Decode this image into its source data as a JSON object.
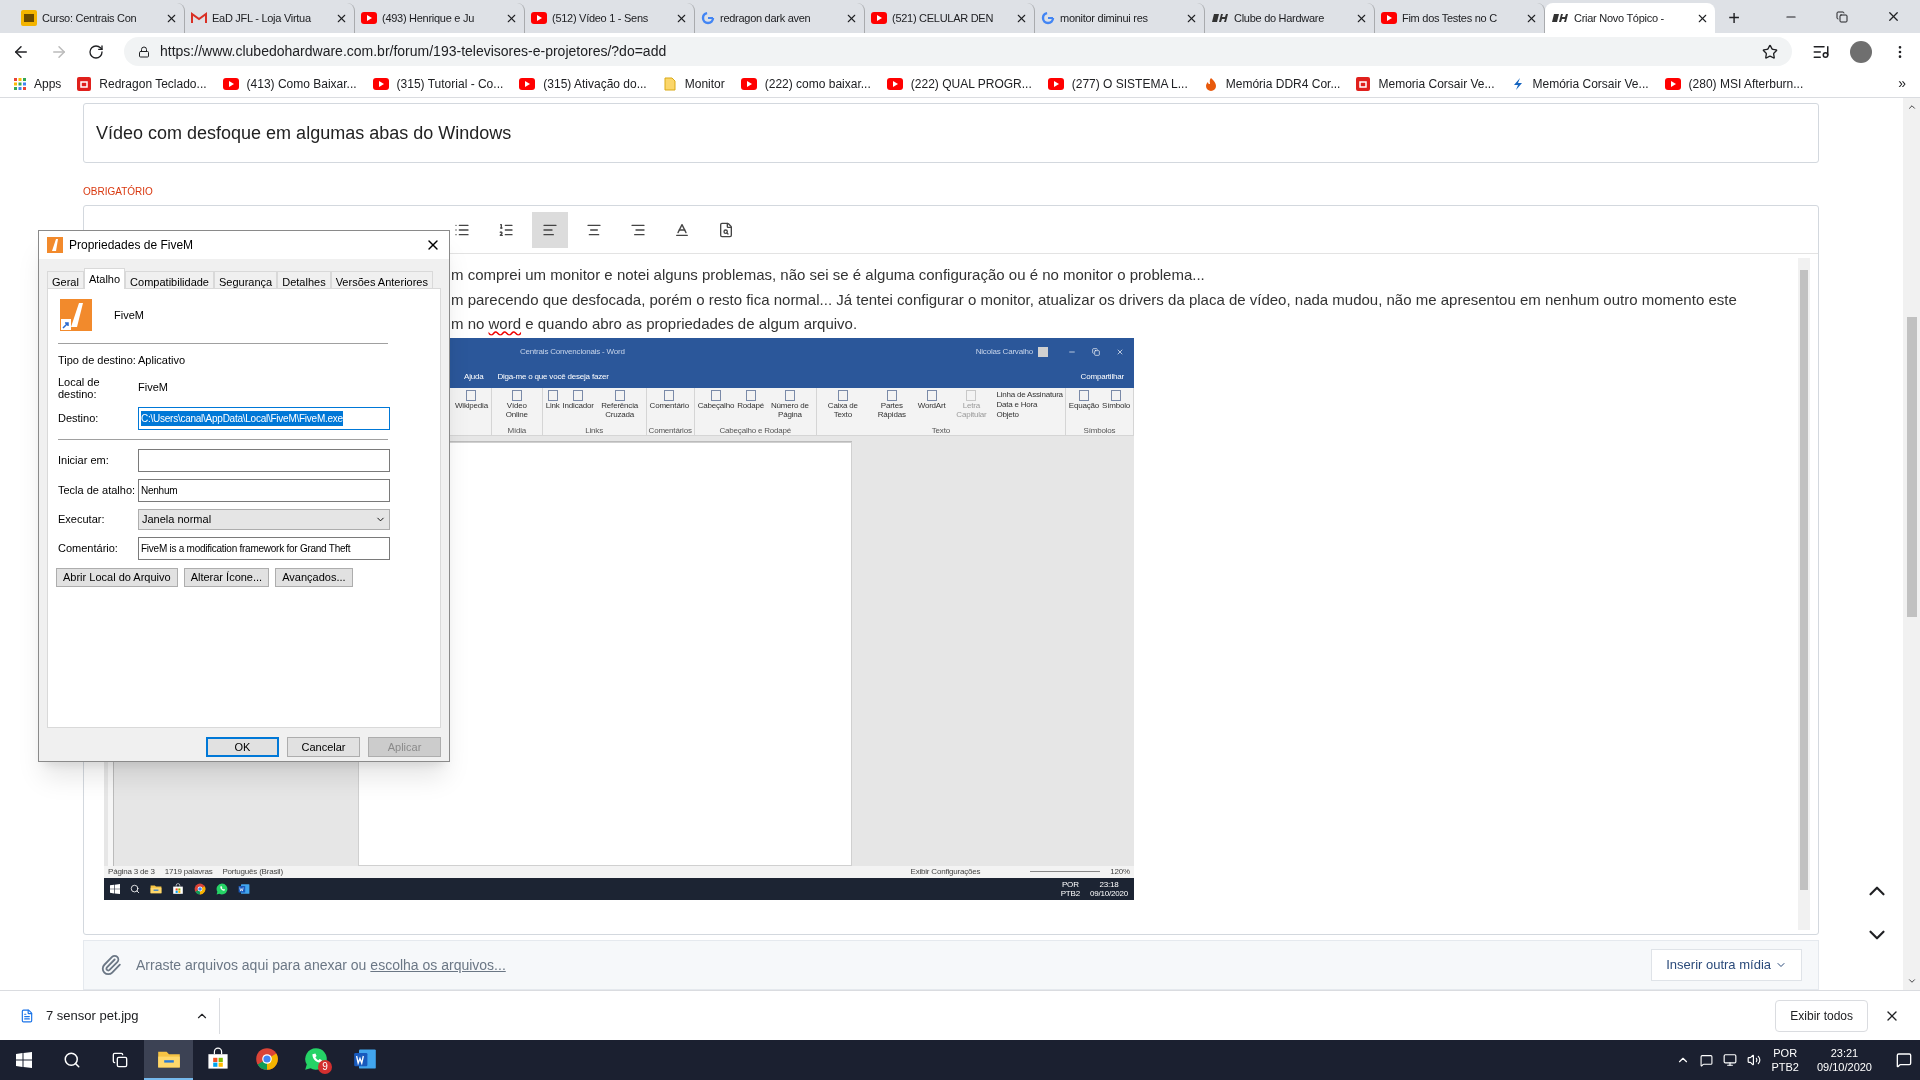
{
  "browser": {
    "tabs": [
      {
        "title": "Curso: Centrais Con",
        "kind": "course",
        "selected": false
      },
      {
        "title": "EaD JFL - Loja Virtua",
        "kind": "gmail",
        "selected": false
      },
      {
        "title": "(493) Henrique e Ju",
        "kind": "youtube",
        "selected": false
      },
      {
        "title": "(512) Vídeo 1 - Sens",
        "kind": "youtube",
        "selected": false
      },
      {
        "title": "redragon dark aven",
        "kind": "google",
        "selected": false
      },
      {
        "title": "(521) CELULAR DEN",
        "kind": "youtube",
        "selected": false
      },
      {
        "title": "monitor diminui res",
        "kind": "google",
        "selected": false
      },
      {
        "title": "Clube do Hardware",
        "kind": "clube",
        "selected": false
      },
      {
        "title": "Fim dos Testes no C",
        "kind": "youtube",
        "selected": false
      },
      {
        "title": "Criar Novo Tópico -",
        "kind": "clube",
        "selected": true
      }
    ],
    "new_tab": "+",
    "url": "https://www.clubedohardware.com.br/forum/193-televisores-e-projetores/?do=add",
    "bookmarks": [
      {
        "label": "Apps",
        "kind": "apps"
      },
      {
        "label": "Redragon Teclado...",
        "kind": "store"
      },
      {
        "label": "(413) Como Baixar...",
        "kind": "youtube"
      },
      {
        "label": "(315) Tutorial - Co...",
        "kind": "youtube"
      },
      {
        "label": "(315) Ativação do...",
        "kind": "youtube"
      },
      {
        "label": "Monitor",
        "kind": "folder"
      },
      {
        "label": "(222) como baixar...",
        "kind": "youtube"
      },
      {
        "label": "(222) QUAL PROGR...",
        "kind": "youtube"
      },
      {
        "label": "(277) O SISTEMA L...",
        "kind": "youtube"
      },
      {
        "label": "Memória DDR4 Cor...",
        "kind": "flame"
      },
      {
        "label": "Memoria Corsair Ve...",
        "kind": "store"
      },
      {
        "label": "Memória Corsair Ve...",
        "kind": "bolt"
      },
      {
        "label": "(280) MSI Afterburn...",
        "kind": "youtube"
      }
    ],
    "bookmarks_more": "»"
  },
  "topic": {
    "title_value": "Vídeo com desfoque em algumas abas do Windows",
    "required_label": "OBRIGATÓRIO",
    "toolbar": [
      {
        "kind": "bullets",
        "selected": false
      },
      {
        "kind": "numbers",
        "selected": false
      },
      {
        "kind": "align-left",
        "selected": true
      },
      {
        "kind": "align-center",
        "selected": false
      },
      {
        "kind": "align-right",
        "selected": false
      },
      {
        "kind": "text-color",
        "selected": false
      },
      {
        "kind": "preview",
        "selected": false
      }
    ],
    "body_lines": [
      {
        "segments": [
          {
            "text": "m comprei um monitor e notei alguns problemas, não sei se é alguma configuração ou é no monitor o problema...",
            "misspelled": false
          }
        ]
      },
      {
        "segments": [
          {
            "text": "m parecendo que desfocada, porém o resto fica normal... Já tentei configurar o monitor, atualizar os drivers da placa de vídeo, nada mudou, não me apresentou em nenhum outro momento este",
            "misspelled": false
          }
        ]
      },
      {
        "segments": [
          {
            "text": "m no ",
            "misspelled": false
          },
          {
            "text": "word",
            "misspelled": true
          },
          {
            "text": " e quando abro as propriedades de algum arquivo.",
            "misspelled": false
          }
        ]
      }
    ],
    "attach_text": "Arraste arquivos aqui para anexar ou",
    "attach_link": "escolha os arquivos...",
    "media_button": "Inserir outra mídia"
  },
  "word_screenshot": {
    "title": "Centrais Convencionais - Word",
    "user": "Nicolas Carvalho",
    "menu": "Ajuda",
    "tell_me": "Diga-me o que você deseja fazer",
    "share": "Compartilhar",
    "groups": [
      {
        "items": [
          {
            "label": "Wikipedia",
            "disabled": false
          }
        ]
      },
      {
        "name": "Mídia",
        "items": [
          {
            "label": "Vídeo Online",
            "disabled": false
          }
        ]
      },
      {
        "name": "Links",
        "items": [
          {
            "label": "Link",
            "disabled": false
          },
          {
            "label": "Indicador",
            "disabled": false
          },
          {
            "label": "Referência Cruzada",
            "disabled": false
          }
        ]
      },
      {
        "name": "Comentários",
        "items": [
          {
            "label": "Comentário",
            "disabled": false
          }
        ]
      },
      {
        "name": "Cabeçalho e Rodapé",
        "items": [
          {
            "label": "Cabeçalho",
            "disabled": false
          },
          {
            "label": "Rodapé",
            "disabled": false
          },
          {
            "label": "Número de Página",
            "disabled": false
          }
        ]
      },
      {
        "name": "Texto",
        "items": [
          {
            "label": "Caixa de Texto",
            "disabled": false
          },
          {
            "label": "Partes Rápidas",
            "disabled": false
          },
          {
            "label": "WordArt",
            "disabled": false
          },
          {
            "label": "Letra Capitular",
            "disabled": true
          }
        ],
        "small_items": [
          "Linha de Assinatura",
          "Data e Hora",
          "Objeto"
        ]
      },
      {
        "name": "Símbolos",
        "items": [
          {
            "label": "Equação",
            "disabled": false
          },
          {
            "label": "Símbolo",
            "disabled": false
          }
        ]
      }
    ],
    "status_left": [
      "Página 3 de 3",
      "1719 palavras",
      "Português (Brasil)"
    ],
    "view_settings": "Exibir Configurações",
    "zoom": "120%",
    "tray_lang": "POR",
    "tray_layout": "PTB2",
    "time": "23:18",
    "date": "09/10/2020"
  },
  "dialog": {
    "title": "Propriedades de FiveM",
    "tabs": [
      {
        "label": "Geral",
        "selected": false
      },
      {
        "label": "Atalho",
        "selected": true
      },
      {
        "label": "Compatibilidade",
        "selected": false
      },
      {
        "label": "Segurança",
        "selected": false
      },
      {
        "label": "Detalhes",
        "selected": false
      },
      {
        "label": "Versões Anteriores",
        "selected": false
      }
    ],
    "app_name": "FiveM",
    "rows": [
      {
        "kind": "static",
        "label": "Tipo de destino:",
        "value": "Aplicativo"
      },
      {
        "kind": "static",
        "label": "Local de destino:",
        "value": "FiveM"
      },
      {
        "kind": "input",
        "label": "Destino:",
        "value": "C:\\Users\\canal\\AppData\\Local\\FiveM\\FiveM.exe",
        "highlighted": true
      },
      {
        "kind": "separator"
      },
      {
        "kind": "input",
        "label": "Iniciar em:",
        "highlighted": false
      },
      {
        "kind": "input",
        "label": "Tecla de atalho:",
        "value": "Nenhum",
        "highlighted": false
      },
      {
        "kind": "select",
        "label": "Executar:",
        "value": "Janela normal"
      },
      {
        "kind": "input",
        "label": "Comentário:",
        "value": "FiveM is a modification framework for Grand Theft",
        "highlighted": false
      }
    ],
    "actions": [
      "Abrir Local do Arquivo",
      "Alterar Ícone...",
      "Avançados..."
    ],
    "footer": [
      {
        "label": "OK",
        "default": true,
        "disabled": false
      },
      {
        "label": "Cancelar",
        "default": false,
        "disabled": false
      },
      {
        "label": "Aplicar",
        "default": false,
        "disabled": true
      }
    ]
  },
  "downloads": {
    "file": "7 sensor pet.jpg",
    "show_all": "Exibir todos"
  },
  "taskbar": {
    "apps": [
      {
        "kind": "explorer",
        "active": true
      },
      {
        "kind": "store",
        "active": false
      },
      {
        "kind": "chrome",
        "active": false
      },
      {
        "kind": "whatsapp",
        "active": false,
        "badge": "9"
      },
      {
        "kind": "word",
        "active": false
      }
    ],
    "lang": "POR",
    "layout": "PTB2",
    "time": "23:21",
    "date": "09/10/2020"
  }
}
